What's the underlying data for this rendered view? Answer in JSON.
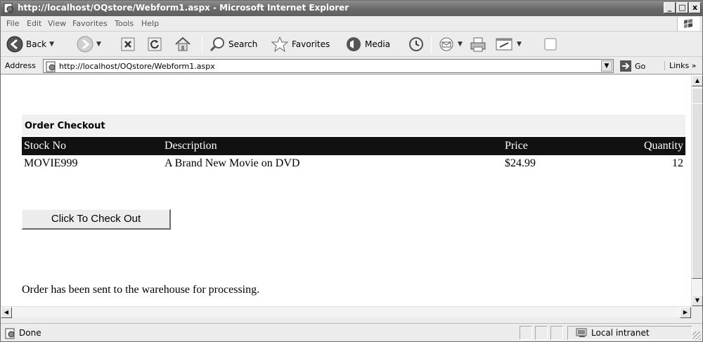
{
  "window": {
    "title": "http://localhost/OQstore/Webform1.aspx - Microsoft Internet Explorer",
    "buttons": [
      "_",
      "□",
      "x"
    ]
  },
  "menu": [
    {
      "label": "File",
      "name": "file"
    },
    {
      "label": "Edit",
      "name": "edit"
    },
    {
      "label": "View",
      "name": "view"
    },
    {
      "label": "Favorites",
      "name": "favorites"
    },
    {
      "label": "Tools",
      "name": "tools"
    },
    {
      "label": "Help",
      "name": "help"
    }
  ],
  "toolbar": {
    "back": "Back",
    "search": "Search",
    "favorites": "Favorites",
    "media": "Media"
  },
  "address": {
    "label": "Address",
    "url": "http://localhost/OQstore/Webform1.aspx",
    "go": "Go",
    "links": "Links"
  },
  "page": {
    "heading": "Order Checkout",
    "columns": [
      "Stock No",
      "Description",
      "Price",
      "Quantity"
    ],
    "rows": [
      {
        "stock_no": "MOVIE999",
        "description": "A Brand New Movie on DVD",
        "price": "$24.99",
        "quantity": "12"
      }
    ],
    "checkout_button": "Click To Check Out",
    "message": "Order has been sent to the warehouse for processing."
  },
  "status": {
    "text": "Done",
    "zone": "Local intranet"
  }
}
